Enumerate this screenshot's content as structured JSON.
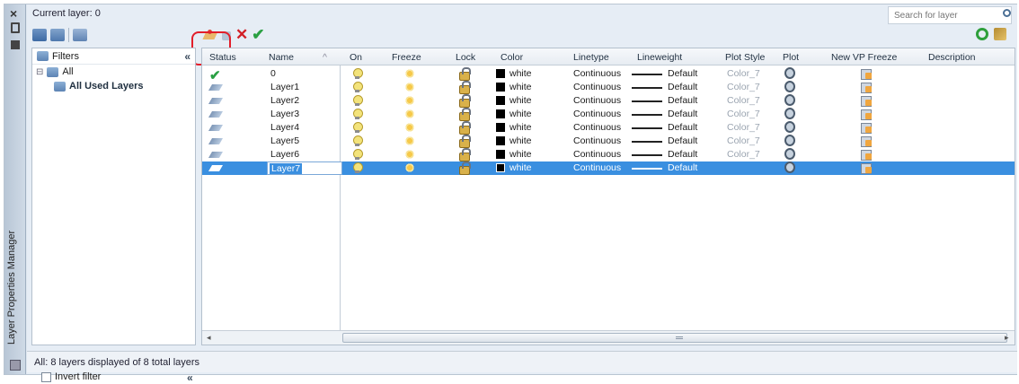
{
  "palette": {
    "title": "Layer Properties Manager"
  },
  "header": {
    "current_layer": "Current layer: 0",
    "search_placeholder": "Search for layer"
  },
  "filters": {
    "header_label": "Filters",
    "items": [
      {
        "label": "All"
      },
      {
        "label": "All Used Layers"
      }
    ],
    "invert_label": "Invert filter"
  },
  "grid": {
    "columns": [
      "Status",
      "Name",
      "On",
      "Freeze",
      "Lock",
      "Color",
      "Linetype",
      "Lineweight",
      "Plot Style",
      "Plot",
      "New VP Freeze",
      "Description"
    ],
    "rows": [
      {
        "status": "current",
        "name": "0",
        "color": "white",
        "linetype": "Continuous",
        "lineweight": "Default",
        "plot_style": "Color_7",
        "selected": false
      },
      {
        "status": "layer",
        "name": "Layer1",
        "color": "white",
        "linetype": "Continuous",
        "lineweight": "Default",
        "plot_style": "Color_7",
        "selected": false
      },
      {
        "status": "layer",
        "name": "Layer2",
        "color": "white",
        "linetype": "Continuous",
        "lineweight": "Default",
        "plot_style": "Color_7",
        "selected": false
      },
      {
        "status": "layer",
        "name": "Layer3",
        "color": "white",
        "linetype": "Continuous",
        "lineweight": "Default",
        "plot_style": "Color_7",
        "selected": false
      },
      {
        "status": "layer",
        "name": "Layer4",
        "color": "white",
        "linetype": "Continuous",
        "lineweight": "Default",
        "plot_style": "Color_7",
        "selected": false
      },
      {
        "status": "layer",
        "name": "Layer5",
        "color": "white",
        "linetype": "Continuous",
        "lineweight": "Default",
        "plot_style": "Color_7",
        "selected": false
      },
      {
        "status": "layer",
        "name": "Layer6",
        "color": "white",
        "linetype": "Continuous",
        "lineweight": "Default",
        "plot_style": "Color_7",
        "selected": false
      },
      {
        "status": "layer",
        "name": "Layer7",
        "color": "white",
        "linetype": "Continuous",
        "lineweight": "Default",
        "plot_style": "",
        "selected": true
      }
    ]
  },
  "status_bar": {
    "text": "All: 8 layers displayed of 8 total layers"
  },
  "colors": {
    "selection": "#3a8fe0",
    "highlight_ring": "#e21e2a",
    "current_check": "#2aa043",
    "delete_x": "#d21f26"
  },
  "icons": {
    "new_layer": "new-layer-icon",
    "delete_layer": "delete-layer-icon",
    "set_current": "set-current-icon"
  }
}
